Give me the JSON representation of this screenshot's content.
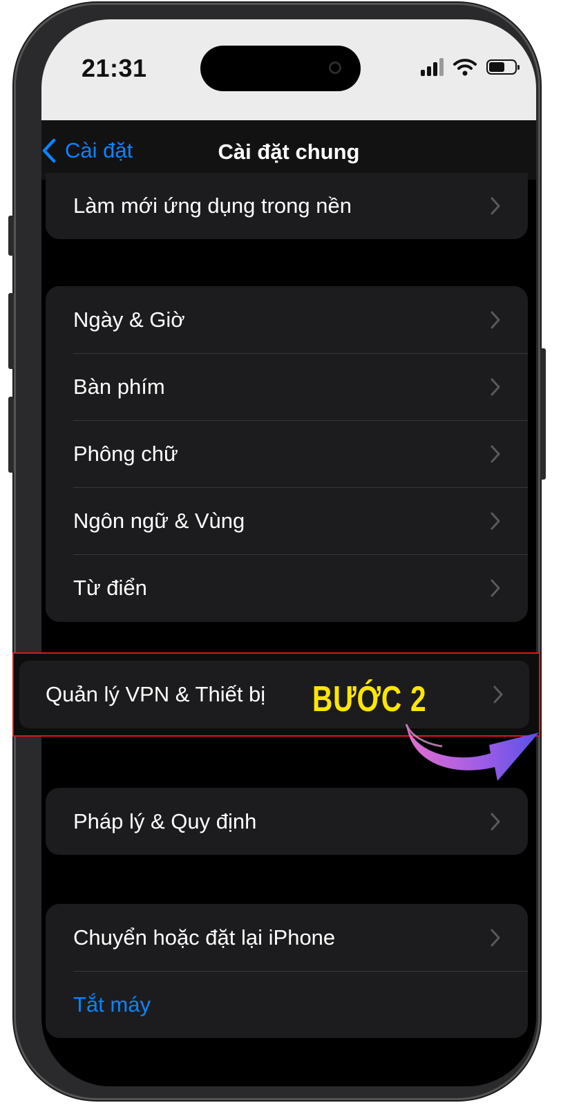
{
  "status_bar": {
    "time": "21:31"
  },
  "nav": {
    "back_label": "Cài đặt",
    "title": "Cài đặt chung"
  },
  "group1": {
    "items": [
      {
        "label": "Làm mới ứng dụng trong nền"
      }
    ]
  },
  "group2": {
    "items": [
      {
        "label": "Ngày & Giờ"
      },
      {
        "label": "Bàn phím"
      },
      {
        "label": "Phông chữ"
      },
      {
        "label": "Ngôn ngữ & Vùng"
      },
      {
        "label": "Từ điển"
      }
    ]
  },
  "highlighted": {
    "label": "Quản lý VPN & Thiết bị",
    "step_label": "BƯỚC 2"
  },
  "group4": {
    "items": [
      {
        "label": "Pháp lý & Quy định"
      }
    ]
  },
  "group5": {
    "items": [
      {
        "label": "Chuyển hoặc đặt lại iPhone"
      },
      {
        "label": "Tắt máy"
      }
    ]
  },
  "colors": {
    "accent": "#0a84ff",
    "highlight_border": "#e0161b",
    "step_text": "#ffe600"
  },
  "icons": {
    "back": "chevron-left-icon",
    "row": "chevron-right-icon"
  }
}
